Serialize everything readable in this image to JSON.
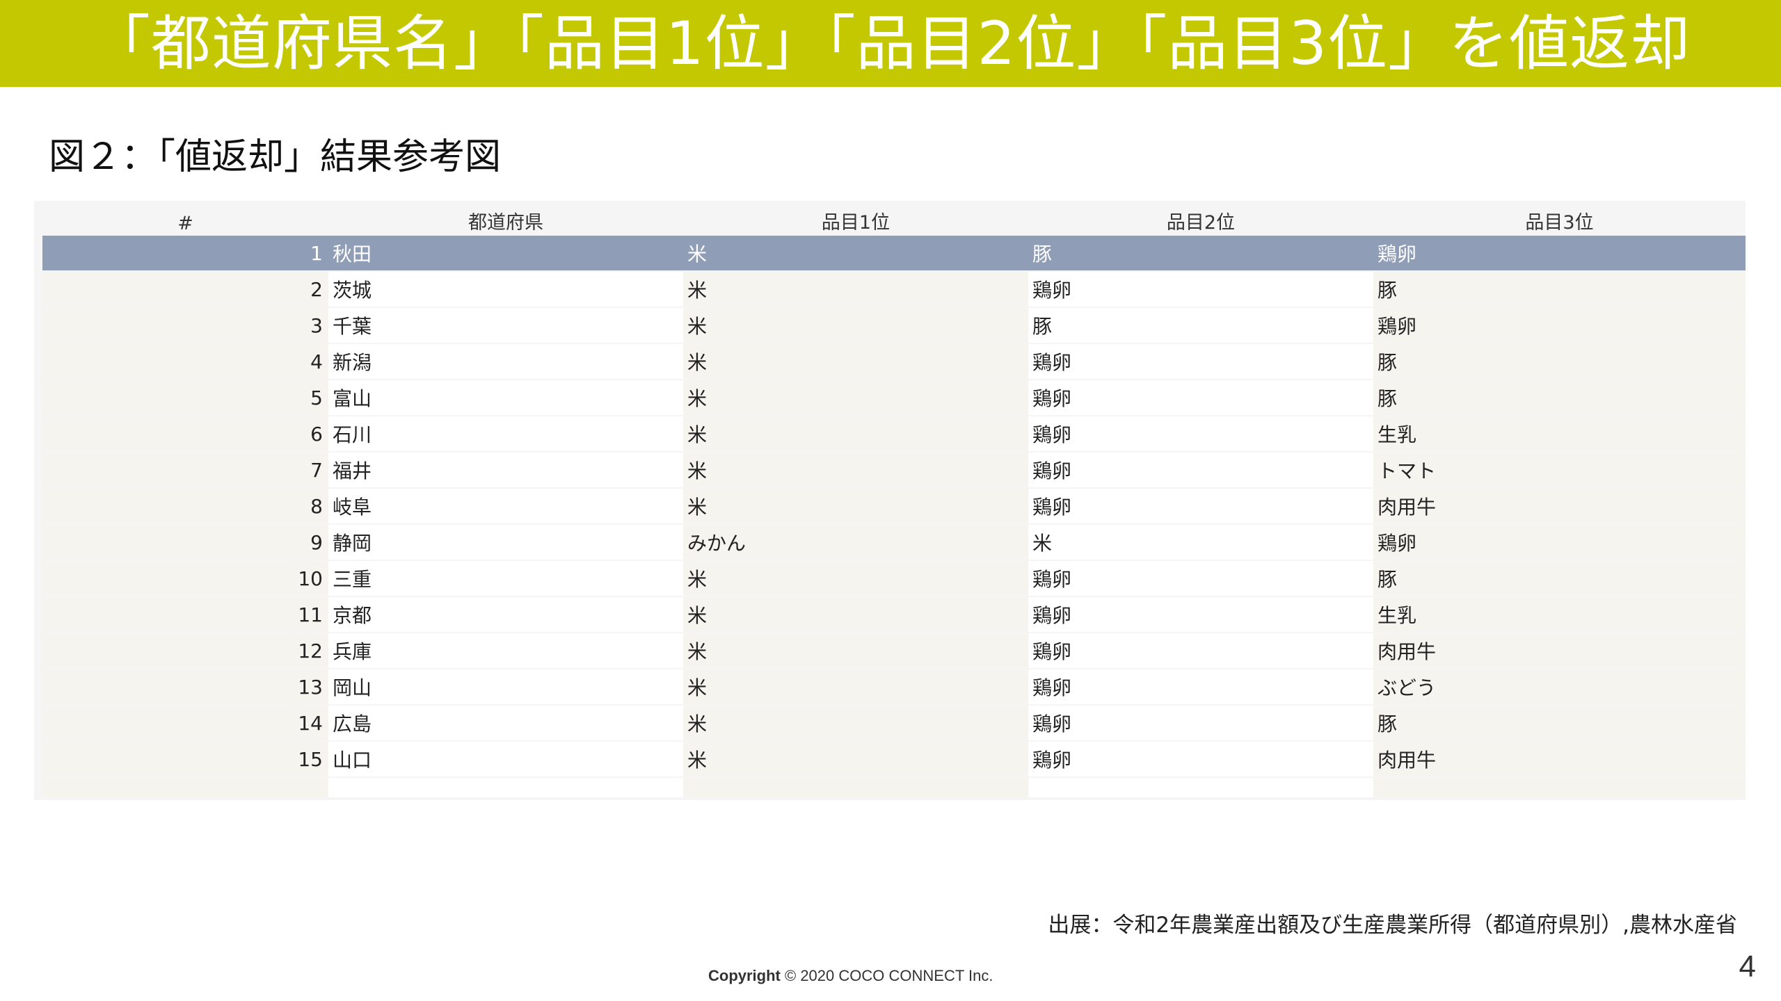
{
  "banner": {
    "title": "「都道府県名」「品目1位」「品目2位」「品目3位」を値返却"
  },
  "figure": {
    "caption": "図２：「値返却」結果参考図"
  },
  "table": {
    "headers": {
      "num": "#",
      "pref": "都道府県",
      "item1": "品目1位",
      "item2": "品目2位",
      "item3": "品目3位"
    },
    "rows": [
      {
        "num": "1",
        "pref": "秋田",
        "item1": "米",
        "item2": "豚",
        "item3": "鶏卵"
      },
      {
        "num": "2",
        "pref": "茨城",
        "item1": "米",
        "item2": "鶏卵",
        "item3": "豚"
      },
      {
        "num": "3",
        "pref": "千葉",
        "item1": "米",
        "item2": "豚",
        "item3": "鶏卵"
      },
      {
        "num": "4",
        "pref": "新潟",
        "item1": "米",
        "item2": "鶏卵",
        "item3": "豚"
      },
      {
        "num": "5",
        "pref": "富山",
        "item1": "米",
        "item2": "鶏卵",
        "item3": "豚"
      },
      {
        "num": "6",
        "pref": "石川",
        "item1": "米",
        "item2": "鶏卵",
        "item3": "生乳"
      },
      {
        "num": "7",
        "pref": "福井",
        "item1": "米",
        "item2": "鶏卵",
        "item3": "トマト"
      },
      {
        "num": "8",
        "pref": "岐阜",
        "item1": "米",
        "item2": "鶏卵",
        "item3": "肉用牛"
      },
      {
        "num": "9",
        "pref": "静岡",
        "item1": "みかん",
        "item2": "米",
        "item3": "鶏卵"
      },
      {
        "num": "10",
        "pref": "三重",
        "item1": "米",
        "item2": "鶏卵",
        "item3": "豚"
      },
      {
        "num": "11",
        "pref": "京都",
        "item1": "米",
        "item2": "鶏卵",
        "item3": "生乳"
      },
      {
        "num": "12",
        "pref": "兵庫",
        "item1": "米",
        "item2": "鶏卵",
        "item3": "肉用牛"
      },
      {
        "num": "13",
        "pref": "岡山",
        "item1": "米",
        "item2": "鶏卵",
        "item3": "ぶどう"
      },
      {
        "num": "14",
        "pref": "広島",
        "item1": "米",
        "item2": "鶏卵",
        "item3": "豚"
      },
      {
        "num": "15",
        "pref": "山口",
        "item1": "米",
        "item2": "鶏卵",
        "item3": "肉用牛"
      }
    ]
  },
  "source_note": "出展：令和2年農業産出額及び生産農業所得（都道府県別）,農林水産省",
  "copyright": {
    "label": "Copyright",
    "text": " © 2020 COCO CONNECT Inc."
  },
  "page_number": "4"
}
